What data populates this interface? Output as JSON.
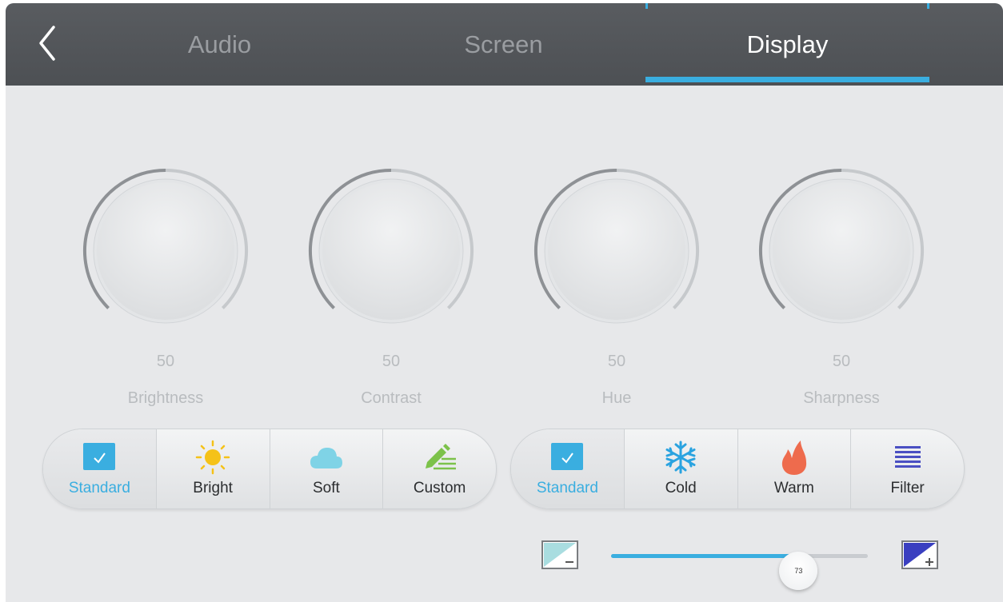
{
  "tabs": [
    {
      "label": "Audio",
      "active": false
    },
    {
      "label": "Screen",
      "active": false
    },
    {
      "label": "Display",
      "active": true
    }
  ],
  "back_icon": "chevron-left-icon",
  "knobs": [
    {
      "label": "Brightness",
      "value": "50"
    },
    {
      "label": "Contrast",
      "value": "50"
    },
    {
      "label": "Hue",
      "value": "50"
    },
    {
      "label": "Sharpness",
      "value": "50"
    }
  ],
  "picture_modes": {
    "selected": "Standard",
    "items": [
      {
        "label": "Standard",
        "icon": "checkbox-icon"
      },
      {
        "label": "Bright",
        "icon": "sun-icon"
      },
      {
        "label": "Soft",
        "icon": "cloud-icon"
      },
      {
        "label": "Custom",
        "icon": "pencil-icon"
      }
    ]
  },
  "color_temp": {
    "selected": "Standard",
    "items": [
      {
        "label": "Standard",
        "icon": "checkbox-icon"
      },
      {
        "label": "Cold",
        "icon": "snowflake-icon"
      },
      {
        "label": "Warm",
        "icon": "flame-icon"
      },
      {
        "label": "Filter",
        "icon": "lines-icon"
      }
    ]
  },
  "slider": {
    "value": "73",
    "level": 0.73,
    "min_icon": "decrease-icon",
    "max_icon": "increase-icon"
  },
  "colors": {
    "accent": "#3aaee0",
    "sun": "#f5c218",
    "cloud": "#7fd3e6",
    "pencil": "#7cc24a",
    "snowflake": "#2aa3e0",
    "flame": "#ee6b4d",
    "filter": "#4a4fc2"
  }
}
